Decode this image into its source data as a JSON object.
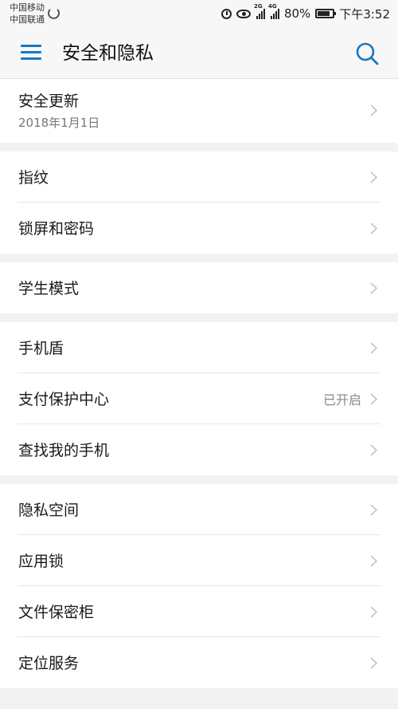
{
  "statusbar": {
    "carrier1": "中国移动",
    "carrier2": "中国联通",
    "net1": "2G",
    "net2": "4G",
    "battery": "80%",
    "time": "下午3:52"
  },
  "appbar": {
    "title": "安全和隐私"
  },
  "colors": {
    "accent": "#1a78c2",
    "background": "#f2f2f2"
  },
  "sections": [
    {
      "items": [
        {
          "label": "安全更新",
          "sub": "2018年1月1日"
        }
      ]
    },
    {
      "items": [
        {
          "label": "指纹"
        },
        {
          "label": "锁屏和密码"
        }
      ]
    },
    {
      "items": [
        {
          "label": "学生模式"
        }
      ]
    },
    {
      "items": [
        {
          "label": "手机盾"
        },
        {
          "label": "支付保护中心",
          "value": "已开启"
        },
        {
          "label": "查找我的手机"
        }
      ]
    },
    {
      "items": [
        {
          "label": "隐私空间"
        },
        {
          "label": "应用锁"
        },
        {
          "label": "文件保密柜"
        },
        {
          "label": "定位服务"
        }
      ]
    }
  ]
}
